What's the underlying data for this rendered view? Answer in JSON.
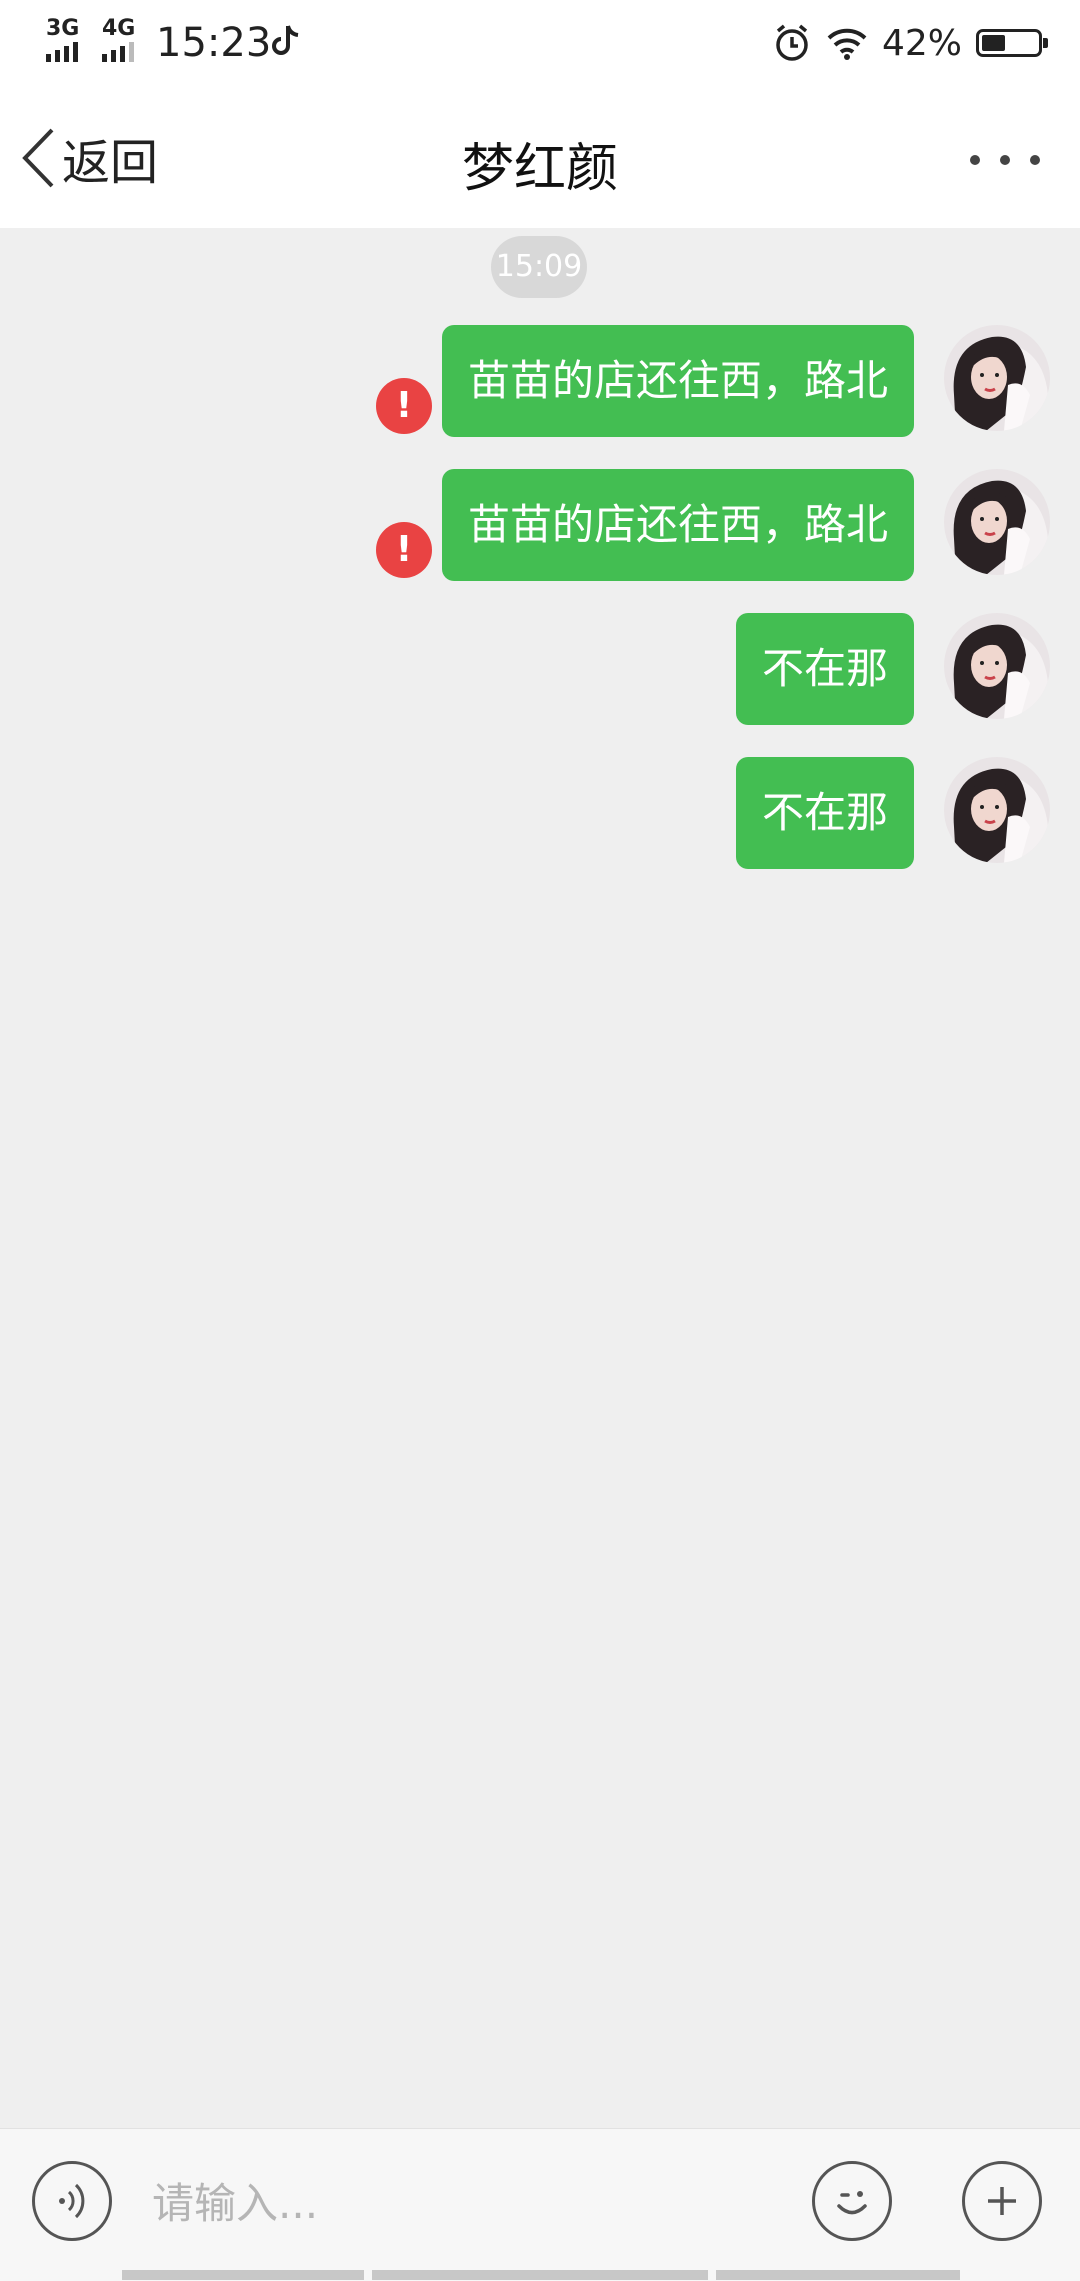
{
  "status_bar": {
    "net1": "3G",
    "net2": "4G",
    "time": "15:23",
    "battery_text": "42%",
    "battery_level": 0.42
  },
  "header": {
    "back_label": "返回",
    "title": "梦红颜"
  },
  "chat": {
    "timestamp": "15:09",
    "messages": [
      {
        "text": "苗苗的店还往西，路北",
        "failed": true
      },
      {
        "text": "苗苗的店还往西，路北",
        "failed": true
      },
      {
        "text": "不在那",
        "failed": false
      },
      {
        "text": "不在那",
        "failed": false
      }
    ],
    "error_mark": "!"
  },
  "input": {
    "placeholder": "请输入..."
  },
  "colors": {
    "bubble": "#43be52",
    "error": "#e94343",
    "background": "#efefef"
  },
  "icons": [
    "back-chevron-icon",
    "more-dots-icon",
    "alarm-icon",
    "wifi-icon",
    "tiktok-icon",
    "voice-icon",
    "emoji-icon",
    "plus-icon"
  ]
}
